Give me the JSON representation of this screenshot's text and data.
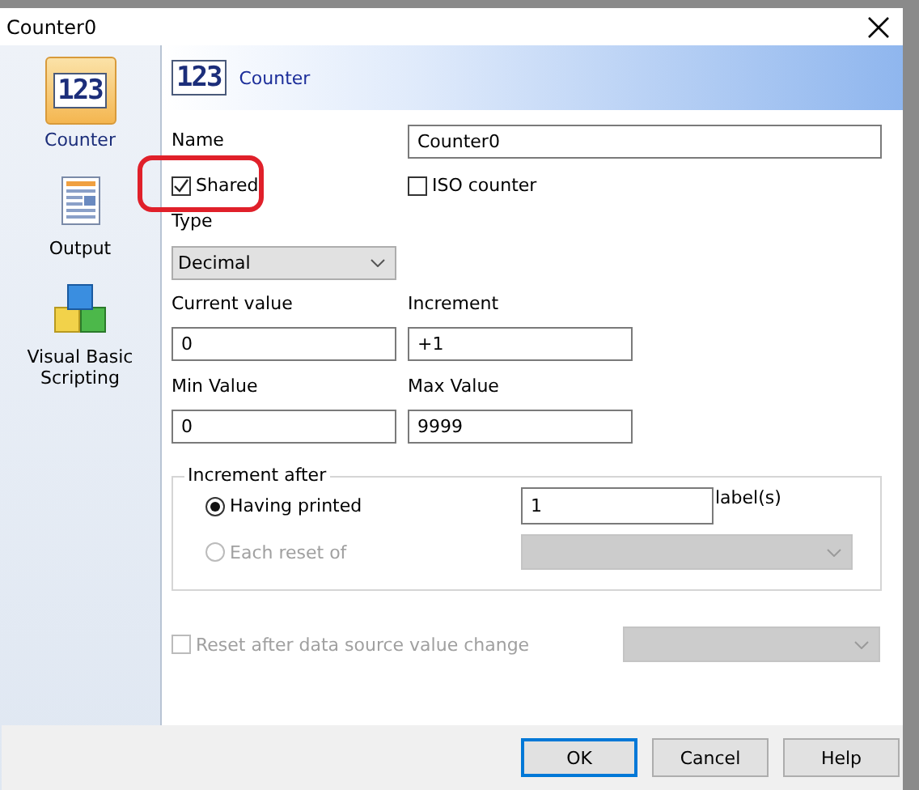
{
  "window": {
    "title": "Counter0"
  },
  "sidebar": {
    "items": [
      {
        "label": "Counter",
        "kind": "counter",
        "icon_text": "123",
        "selected": true
      },
      {
        "label": "Output",
        "kind": "output",
        "selected": false
      },
      {
        "label": "Visual Basic Scripting",
        "kind": "script",
        "selected": false
      }
    ]
  },
  "header": {
    "title": "Counter",
    "icon_text": "123"
  },
  "form": {
    "name": {
      "label": "Name",
      "value": "Counter0"
    },
    "shared": {
      "label": "Shared",
      "checked": true,
      "highlighted": true
    },
    "iso_counter": {
      "label": "ISO counter",
      "checked": false
    },
    "type": {
      "label": "Type",
      "value": "Decimal"
    },
    "current_value": {
      "label": "Current value",
      "value": "0"
    },
    "increment": {
      "label": "Increment",
      "value": "+1"
    },
    "min_value": {
      "label": "Min Value",
      "value": "0"
    },
    "max_value": {
      "label": "Max Value",
      "value": "9999"
    }
  },
  "increment_after": {
    "title": "Increment after",
    "options": [
      {
        "label": "Having printed",
        "selected": true,
        "disabled": false,
        "kind": "count",
        "value": "1",
        "unit": "label(s)"
      },
      {
        "label": "Each reset of",
        "selected": false,
        "disabled": true,
        "kind": "dropdown"
      }
    ]
  },
  "reset_after_change": {
    "label": "Reset after data source value change",
    "checked": false,
    "disabled": true
  },
  "buttons": [
    {
      "label": "OK",
      "default": true
    },
    {
      "label": "Cancel",
      "default": false
    },
    {
      "label": "Help",
      "default": false
    }
  ]
}
